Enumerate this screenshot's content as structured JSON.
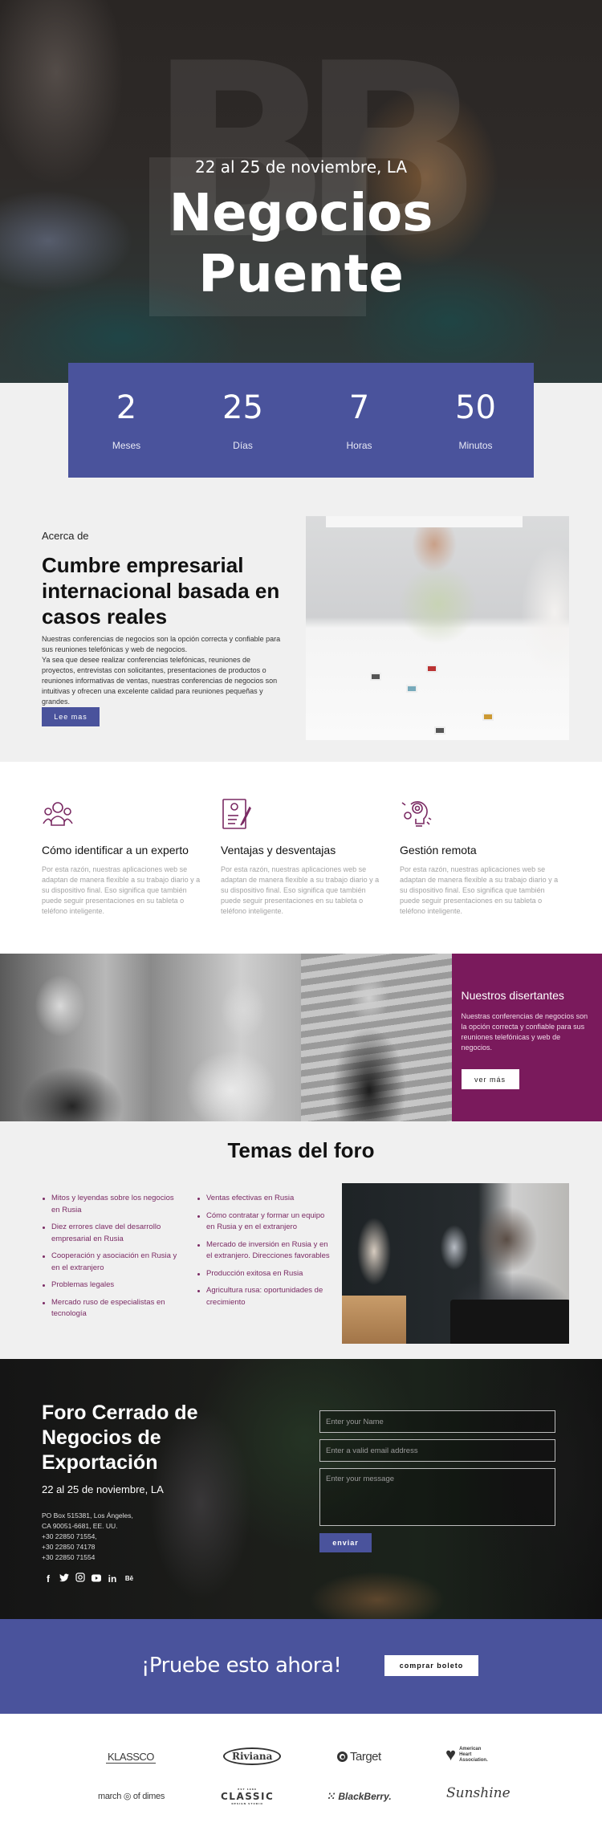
{
  "hero": {
    "date": "22 al 25 de noviembre, LA",
    "title_line1": "Negocios",
    "title_line2": "Puente",
    "watermark": "BB"
  },
  "countdown": [
    {
      "value": "2",
      "label": "Meses"
    },
    {
      "value": "25",
      "label": "Días"
    },
    {
      "value": "7",
      "label": "Horas"
    },
    {
      "value": "50",
      "label": "Minutos"
    }
  ],
  "about": {
    "kicker": "Acerca de",
    "title": "Cumbre empresarial internacional basada en casos reales",
    "paragraph1": "Nuestras conferencias de negocios son la opción correcta y confiable para sus reuniones telefónicas y web de negocios.",
    "paragraph2": "Ya sea que desee realizar conferencias telefónicas, reuniones de proyectos, entrevistas con solicitantes, presentaciones de productos o reuniones informativas de ventas, nuestras conferencias de negocios son intuitivas y ofrecen una excelente calidad para reuniones pequeñas y grandes.",
    "button": "Lee mas"
  },
  "features": [
    {
      "icon": "team-icon",
      "title": "Cómo identificar a un experto",
      "text": "Por esta razón, nuestras aplicaciones web se adaptan de manera flexible a su trabajo diario y a su dispositivo final. Eso significa que también puede seguir presentaciones en su tableta o teléfono inteligente."
    },
    {
      "icon": "resume-icon",
      "title": "Ventajas y desventajas",
      "text": "Por esta razón, nuestras aplicaciones web se adaptan de manera flexible a su trabajo diario y a su dispositivo final. Eso significa que también puede seguir presentaciones en su tableta o teléfono inteligente."
    },
    {
      "icon": "gear-bulb-icon",
      "title": "Gestión remota",
      "text": "Por esta razón, nuestras aplicaciones web se adaptan de manera flexible a su trabajo diario y a su dispositivo final. Eso significa que también puede seguir presentaciones en su tableta o teléfono inteligente."
    }
  ],
  "speakers": {
    "title": "Nuestros disertantes",
    "text": "Nuestras conferencias de negocios son la opción correcta y confiable para sus reuniones telefónicas y web de negocios.",
    "button": "ver más"
  },
  "topics": {
    "title": "Temas del foro",
    "column1": [
      "Mitos y leyendas sobre los negocios en Rusia",
      "Diez errores clave del desarrollo empresarial en Rusia",
      "Cooperación y asociación en Rusia y en el extranjero",
      "Problemas legales",
      "Mercado ruso de especialistas en tecnología"
    ],
    "column2": [
      "Ventas efectivas en Rusia",
      "Cómo contratar y formar un equipo en Rusia y en el extranjero",
      "Mercado de inversión en Rusia y en el extranjero. Direcciones favorables",
      "Producción exitosa en Rusia",
      "Agricultura rusa: oportunidades de crecimiento"
    ]
  },
  "contact": {
    "title": "Foro Cerrado de Negocios de Exportación",
    "date": "22 al 25 de noviembre, LA",
    "address": [
      "PO Box 515381, Los Ángeles,",
      "CA 90051-6681, EE. UU.",
      "+30 22850 71554,",
      "+30 22850 74178",
      "+30 22850 71554"
    ],
    "social": [
      {
        "name": "facebook-icon",
        "glyph": "f"
      },
      {
        "name": "twitter-icon",
        "glyph": "🐦"
      },
      {
        "name": "instagram-icon",
        "glyph": "◎"
      },
      {
        "name": "youtube-icon",
        "glyph": "▶"
      },
      {
        "name": "linkedin-icon",
        "glyph": "in"
      },
      {
        "name": "behance-icon",
        "glyph": "Bē"
      }
    ],
    "form": {
      "name_placeholder": "Enter your Name",
      "email_placeholder": "Enter a valid email address",
      "message_placeholder": "Enter your message",
      "submit": "enviar"
    }
  },
  "cta": {
    "text": "¡Pruebe esto ahora!",
    "button": "comprar boleto"
  },
  "logos": {
    "klassco": "KLASSCO",
    "riviana": "Riviana",
    "target": "Target",
    "aha": [
      "American",
      "Heart",
      "Association."
    ],
    "march": "march ◎ of dimes",
    "classic_top": "EST 1986",
    "classic": "CLASSIC",
    "classic_bottom": "DESIGN STUDIO",
    "blackberry": "⁙ BlackBerry.",
    "sunshine": "Sunshine"
  },
  "colors": {
    "accent_blue": "#4a539c",
    "accent_plum": "#7a1a5c",
    "topic_text": "#7a2a63"
  }
}
